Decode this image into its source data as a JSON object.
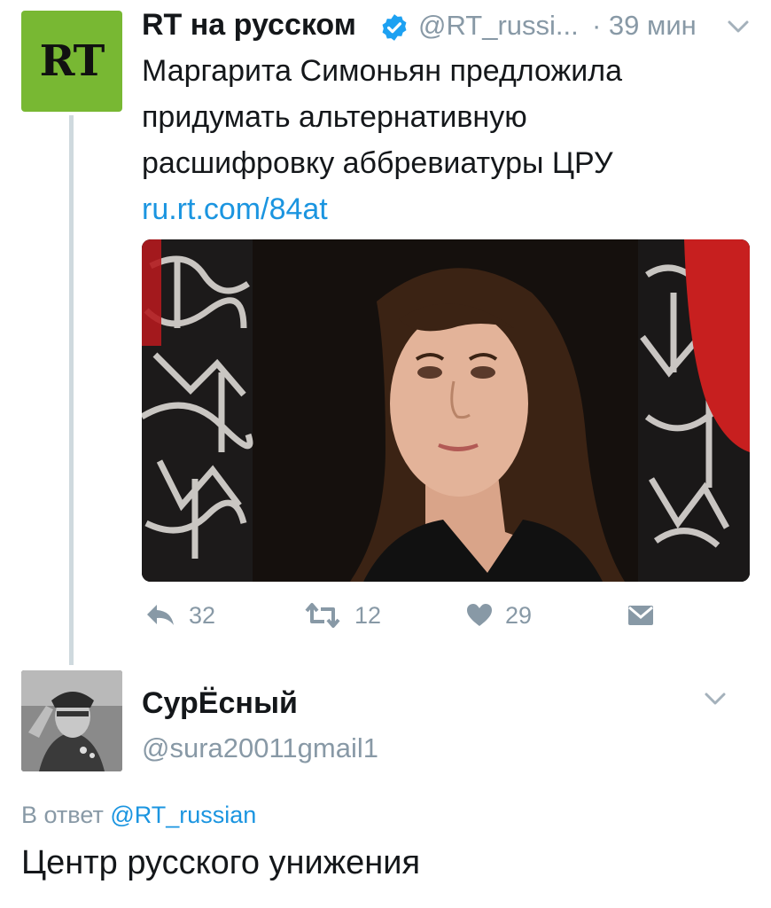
{
  "tweet": {
    "avatar_text": "RT",
    "author_name": "RT на русском",
    "handle": "@RT_russi...",
    "time": "· 39 мин",
    "text_lines": [
      "Маргарита Симоньян предложила",
      "придумать альтернативную",
      "расшифровку аббревиатуры ЦРУ"
    ],
    "link": "ru.rt.com/84at",
    "actions": {
      "reply_count": "32",
      "retweet_count": "12",
      "like_count": "29"
    }
  },
  "reply": {
    "author_name": "СурЁсный",
    "handle": "@sura20011gmail1",
    "in_reply_prefix": "В ответ",
    "in_reply_handle": "@RT_russian",
    "text": "Центр русского унижения"
  },
  "colors": {
    "rt_green": "#78b833",
    "link_blue": "#1b95e0",
    "muted_gray": "#8899a6",
    "thread_line": "#cfd9de"
  },
  "icons": [
    "verified-icon",
    "chevron-down-icon",
    "reply-icon",
    "retweet-icon",
    "like-icon",
    "direct-message-icon"
  ]
}
